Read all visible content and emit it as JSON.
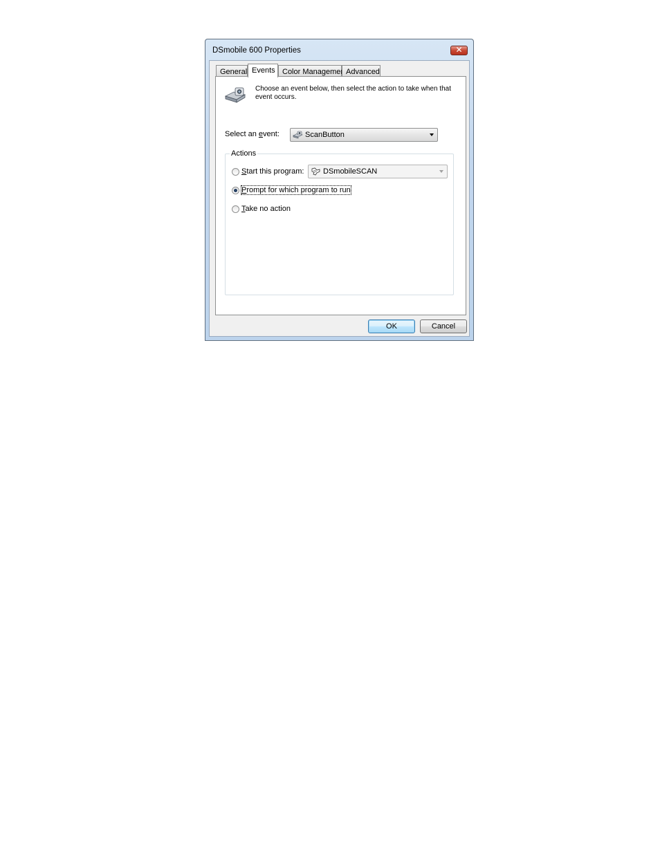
{
  "window": {
    "title": "DSmobile 600 Properties",
    "close_glyph": "✕"
  },
  "tabs": [
    {
      "label": "General",
      "active": false
    },
    {
      "label": "Events",
      "active": true
    },
    {
      "label": "Color Management",
      "active": false
    },
    {
      "label": "Advanced",
      "active": false
    }
  ],
  "events_panel": {
    "description": "Choose an event below, then select the action to take when that event occurs.",
    "select_event_label_pre": "Select an ",
    "select_event_label_ul": "e",
    "select_event_label_post": "vent:",
    "selected_event": "ScanButton",
    "actions_group_title": "Actions",
    "actions": {
      "start_program": {
        "pre": "",
        "ul": "S",
        "post": "tart this program:",
        "selected": false
      },
      "program_value": "DSmobileSCAN",
      "prompt": {
        "pre": "",
        "ul": "P",
        "post": "rompt for which program to run",
        "selected": true
      },
      "no_action": {
        "pre": "",
        "ul": "T",
        "post": "ake no action",
        "selected": false
      }
    }
  },
  "buttons": {
    "ok": "OK",
    "cancel": "Cancel"
  },
  "icons": {
    "scanner": "scanner-icon",
    "event_combo": "scanner-small-icon",
    "program_combo": "program-icon"
  },
  "colors": {
    "accent": "#3c7fb1",
    "close_red": "#c84a35",
    "frame": "#c3d7ee"
  }
}
